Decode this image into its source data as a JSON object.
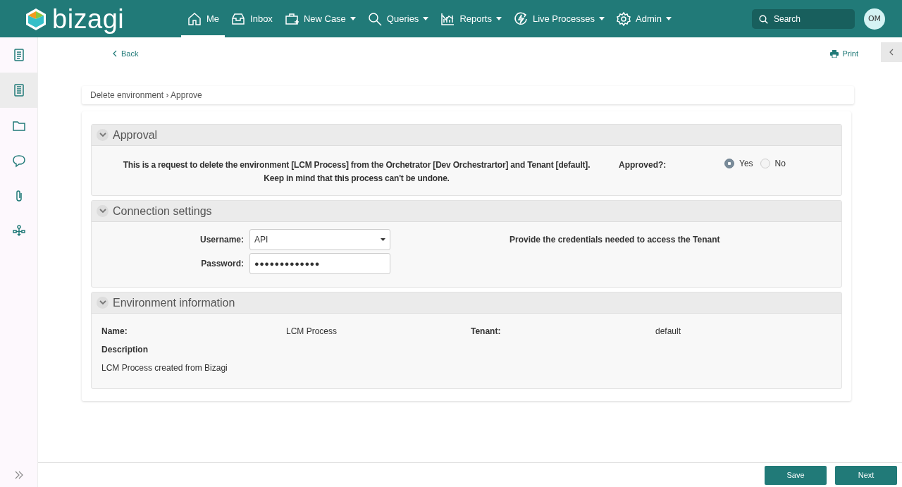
{
  "header": {
    "logo": "bizagi",
    "nav": [
      {
        "label": "Me",
        "selected": true,
        "dropdown": false
      },
      {
        "label": "Inbox",
        "selected": false,
        "dropdown": false
      },
      {
        "label": "New Case",
        "selected": false,
        "dropdown": true
      },
      {
        "label": "Queries",
        "selected": false,
        "dropdown": true
      },
      {
        "label": "Reports",
        "selected": false,
        "dropdown": true
      },
      {
        "label": "Live Processes",
        "selected": false,
        "dropdown": true
      },
      {
        "label": "Admin",
        "selected": false,
        "dropdown": true
      }
    ],
    "search": {
      "placeholder": "Search"
    },
    "avatar": "OM"
  },
  "sidebar": {
    "items": [
      {
        "selected": false
      },
      {
        "selected": true
      },
      {
        "selected": false
      },
      {
        "selected": false
      },
      {
        "selected": false
      },
      {
        "selected": false
      }
    ]
  },
  "toolbar": {
    "back": "Back",
    "print": "Print"
  },
  "breadcrumb": {
    "process": "Delete environment",
    "separator": "›",
    "task": "Approve"
  },
  "panels": [
    {
      "kind": "approval",
      "title": "Approval",
      "expanded": true,
      "message": [
        "This is a request to delete the environment [LCM Process] from the Orchetrator [Dev Orchestrartor] and Tenant [default].",
        "Keep in mind that this process can't be undone."
      ],
      "question": "Approved?:",
      "options": [
        {
          "label": "Yes",
          "selected": true
        },
        {
          "label": "No",
          "selected": false
        }
      ]
    },
    {
      "kind": "connection",
      "title": "Connection settings",
      "expanded": true,
      "username_label": "Username:",
      "username": "API",
      "password_label": "Password:",
      "password": "●●●●●●●●●●●●●",
      "hint": "Provide the credentials needed to access the Tenant"
    },
    {
      "kind": "environment",
      "title": "Environment information",
      "expanded": true,
      "name_label": "Name:",
      "name": "LCM Process",
      "tenant_label": "Tenant:",
      "tenant": "default",
      "description_label": "Description",
      "description": "LCM Process created from Bizagi"
    }
  ],
  "footer": {
    "buttons": [
      "Save",
      "Next"
    ]
  }
}
